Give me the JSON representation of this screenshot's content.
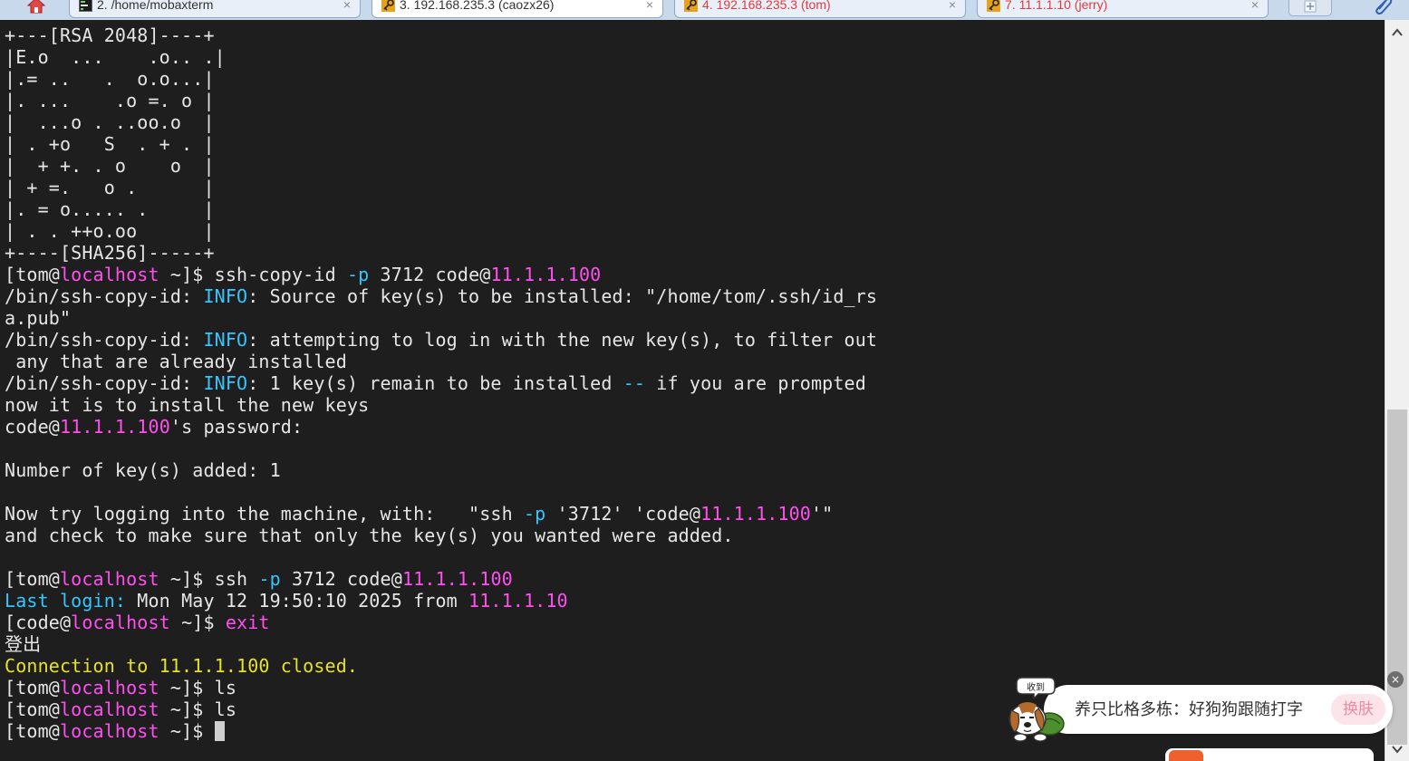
{
  "tabs": [
    {
      "label": "2. /home/mobaxterm",
      "icon": "terminal-icon",
      "color": "#333333",
      "active": false
    },
    {
      "label": "3. 192.168.235.3 (caozx26)",
      "icon": "ssh-key-icon",
      "color": "#333333",
      "active": true
    },
    {
      "label": "4. 192.168.235.3 (tom)",
      "icon": "ssh-key-icon",
      "color": "#e23b3b",
      "active": false
    },
    {
      "label": "7. 11.1.1.10 (jerry)",
      "icon": "ssh-key-icon",
      "color": "#e23b3b",
      "active": false
    }
  ],
  "tab_close_glyph": "×",
  "terminal": {
    "lines": [
      [
        {
          "t": "+---[RSA 2048]----+"
        }
      ],
      [
        {
          "t": "|E.o  ...    .o.. .|"
        }
      ],
      [
        {
          "t": "|.= ..   .  o.o...|"
        }
      ],
      [
        {
          "t": "|. ...    .o =. o |"
        }
      ],
      [
        {
          "t": "|  ...o . ..oo.o  |"
        }
      ],
      [
        {
          "t": "| . +o   S  . + . |"
        }
      ],
      [
        {
          "t": "|  + +. . o    o  |"
        }
      ],
      [
        {
          "t": "| + =.   o .      |"
        }
      ],
      [
        {
          "t": "|. = o..... .     |"
        }
      ],
      [
        {
          "t": "| . . ++o.oo      |"
        }
      ],
      [
        {
          "t": "+----[SHA256]-----+"
        }
      ],
      [
        {
          "t": "[tom@"
        },
        {
          "t": "localhost",
          "c": "pink"
        },
        {
          "t": " ~]$ ssh-copy-id "
        },
        {
          "t": "-p",
          "c": "cyan"
        },
        {
          "t": " 3712 code@"
        },
        {
          "t": "11.1.1.100",
          "c": "pink"
        }
      ],
      [
        {
          "t": "/bin/ssh-copy-id: "
        },
        {
          "t": "INFO",
          "c": "cyan"
        },
        {
          "t": ": Source of key(s) to be installed: \"/home/tom/.ssh/id_rs"
        }
      ],
      [
        {
          "t": "a.pub\""
        }
      ],
      [
        {
          "t": "/bin/ssh-copy-id: "
        },
        {
          "t": "INFO",
          "c": "cyan"
        },
        {
          "t": ": attempting to log in with the new key(s), to filter out"
        }
      ],
      [
        {
          "t": " any that are already installed"
        }
      ],
      [
        {
          "t": "/bin/ssh-copy-id: "
        },
        {
          "t": "INFO",
          "c": "cyan"
        },
        {
          "t": ": 1 key(s) remain to be installed "
        },
        {
          "t": "--",
          "c": "cyan"
        },
        {
          "t": " if you are prompted"
        }
      ],
      [
        {
          "t": "now it is to install the new keys"
        }
      ],
      [
        {
          "t": "code@"
        },
        {
          "t": "11.1.1.100",
          "c": "pink"
        },
        {
          "t": "'s password:"
        }
      ],
      [
        {
          "t": ""
        }
      ],
      [
        {
          "t": "Number of key(s) added: 1"
        }
      ],
      [
        {
          "t": ""
        }
      ],
      [
        {
          "t": "Now try logging into the machine, with:   \"ssh "
        },
        {
          "t": "-p",
          "c": "cyan"
        },
        {
          "t": " '3712' 'code@"
        },
        {
          "t": "11.1.1.100",
          "c": "pink"
        },
        {
          "t": "'\""
        }
      ],
      [
        {
          "t": "and check to make sure that only the key(s) you wanted were added."
        }
      ],
      [
        {
          "t": ""
        }
      ],
      [
        {
          "t": "[tom@"
        },
        {
          "t": "localhost",
          "c": "pink"
        },
        {
          "t": " ~]$ ssh "
        },
        {
          "t": "-p",
          "c": "cyan"
        },
        {
          "t": " 3712 code@"
        },
        {
          "t": "11.1.1.100",
          "c": "pink"
        }
      ],
      [
        {
          "t": "Last login:",
          "c": "cyan"
        },
        {
          "t": " Mon May 12 19:50:10 2025 from "
        },
        {
          "t": "11.1.1.10",
          "c": "pink"
        }
      ],
      [
        {
          "t": "[code@"
        },
        {
          "t": "localhost",
          "c": "pink"
        },
        {
          "t": " ~]$ "
        },
        {
          "t": "exit",
          "c": "pink"
        }
      ],
      [
        {
          "t": "登出"
        }
      ],
      [
        {
          "t": "Connection to 11.1.1.100 closed.",
          "c": "yellow"
        }
      ],
      [
        {
          "t": "[tom@"
        },
        {
          "t": "localhost",
          "c": "pink"
        },
        {
          "t": " ~]$ ls"
        }
      ],
      [
        {
          "t": "[tom@"
        },
        {
          "t": "localhost",
          "c": "pink"
        },
        {
          "t": " ~]$ ls"
        }
      ],
      [
        {
          "t": "[tom@"
        },
        {
          "t": "localhost",
          "c": "pink"
        },
        {
          "t": " ~]$ "
        },
        {
          "cursor": true
        }
      ]
    ]
  },
  "ime_popup": {
    "badge": "收到",
    "text": "养只比格多栋：好狗狗跟随打字",
    "skin_button": "换肤",
    "close_glyph": "×"
  },
  "colors": {
    "background": "#1e1e1e",
    "text": "#e6e6e6",
    "pink": "#ff4ff0",
    "cyan": "#36c6ff",
    "yellow": "#e6e22a"
  }
}
